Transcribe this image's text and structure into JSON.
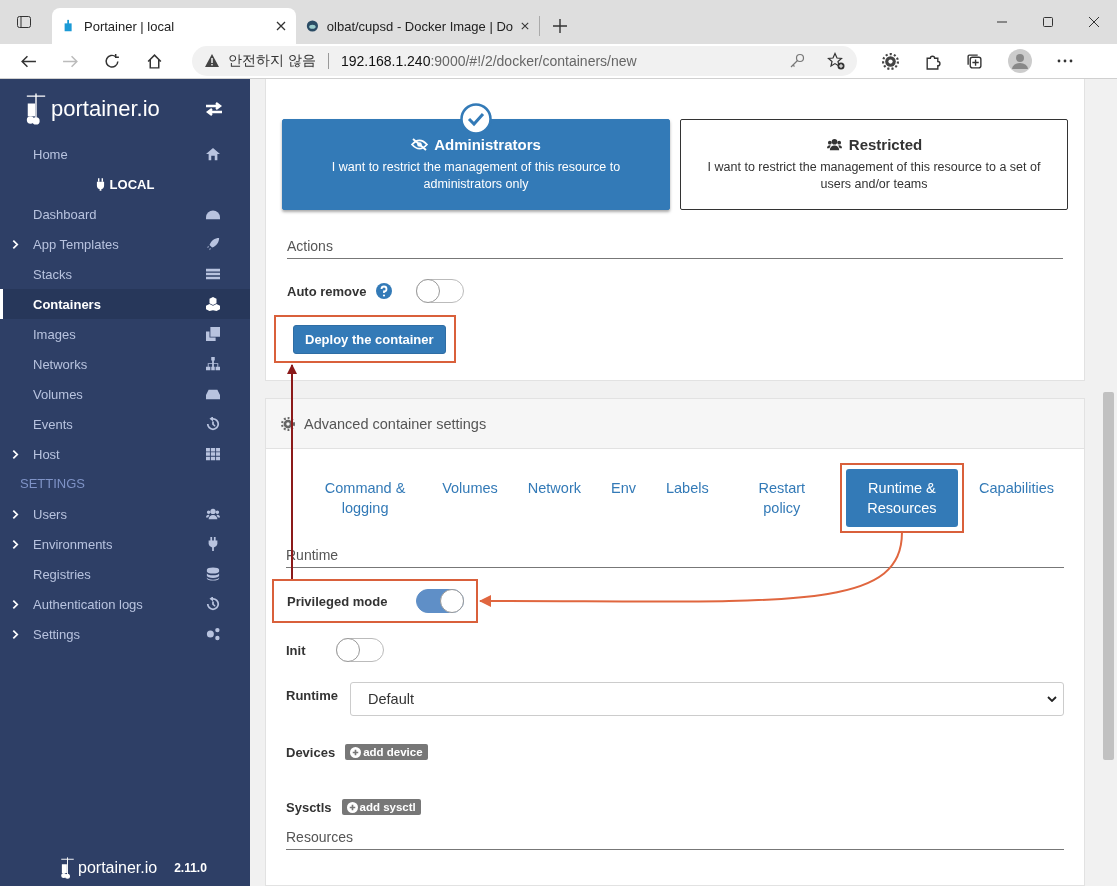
{
  "browser": {
    "tabs": [
      {
        "title": "Portainer | local",
        "selected": true
      },
      {
        "title": "olbat/cupsd - Docker Image | Do",
        "selected": false
      }
    ],
    "security_label": "안전하지 않음",
    "url_host": "192.168.1.240",
    "url_rest": ":9000/#!/2/docker/containers/new"
  },
  "sidebar": {
    "logo": "portainer.io",
    "items": [
      {
        "kind": "link",
        "label": "Home",
        "expandable": false,
        "selected": false
      },
      {
        "kind": "endpoint",
        "label": "LOCAL"
      },
      {
        "kind": "link",
        "label": "Dashboard",
        "expandable": false,
        "selected": false
      },
      {
        "kind": "link",
        "label": "App Templates",
        "expandable": true,
        "selected": false
      },
      {
        "kind": "link",
        "label": "Stacks",
        "expandable": false,
        "selected": false
      },
      {
        "kind": "link",
        "label": "Containers",
        "expandable": false,
        "selected": true
      },
      {
        "kind": "link",
        "label": "Images",
        "expandable": false,
        "selected": false
      },
      {
        "kind": "link",
        "label": "Networks",
        "expandable": false,
        "selected": false
      },
      {
        "kind": "link",
        "label": "Volumes",
        "expandable": false,
        "selected": false
      },
      {
        "kind": "link",
        "label": "Events",
        "expandable": false,
        "selected": false
      },
      {
        "kind": "link",
        "label": "Host",
        "expandable": true,
        "selected": false
      },
      {
        "kind": "heading",
        "label": "SETTINGS"
      },
      {
        "kind": "link",
        "label": "Users",
        "expandable": true,
        "selected": false
      },
      {
        "kind": "link",
        "label": "Environments",
        "expandable": true,
        "selected": false
      },
      {
        "kind": "link",
        "label": "Registries",
        "expandable": false,
        "selected": false
      },
      {
        "kind": "link",
        "label": "Authentication logs",
        "expandable": true,
        "selected": false
      },
      {
        "kind": "link",
        "label": "Settings",
        "expandable": true,
        "selected": false
      }
    ],
    "footer_logo": "portainer.io",
    "version": "2.11.0"
  },
  "access_control": {
    "options": [
      {
        "title": "Administrators",
        "description": "I want to restrict the management of this resource to administrators only",
        "selected": true
      },
      {
        "title": "Restricted",
        "description": "I want to restrict the management of this resource to a set of users and/or teams",
        "selected": false
      }
    ]
  },
  "actions": {
    "title": "Actions",
    "auto_remove": {
      "label": "Auto remove",
      "on": false
    },
    "deploy_button": {
      "label": "Deploy the container",
      "highlighted": true
    }
  },
  "advanced": {
    "title": "Advanced container settings",
    "tabs": [
      {
        "label": "Command & logging",
        "selected": false,
        "highlighted": false
      },
      {
        "label": "Volumes",
        "selected": false,
        "highlighted": false
      },
      {
        "label": "Network",
        "selected": false,
        "highlighted": false
      },
      {
        "label": "Env",
        "selected": false,
        "highlighted": false
      },
      {
        "label": "Labels",
        "selected": false,
        "highlighted": false
      },
      {
        "label": "Restart policy",
        "selected": false,
        "highlighted": false
      },
      {
        "label": "Runtime & Resources",
        "selected": true,
        "highlighted": true
      },
      {
        "label": "Capabilities",
        "selected": false,
        "highlighted": false
      }
    ],
    "runtime_title": "Runtime",
    "privileged": {
      "label": "Privileged mode",
      "on": true,
      "highlighted": true
    },
    "init": {
      "label": "Init",
      "on": false
    },
    "runtime_select": {
      "label": "Runtime",
      "value": "Default"
    },
    "devices": {
      "label": "Devices",
      "button": "add device"
    },
    "sysctls": {
      "label": "Sysctls",
      "button": "add sysctl"
    },
    "resources_title": "Resources"
  }
}
